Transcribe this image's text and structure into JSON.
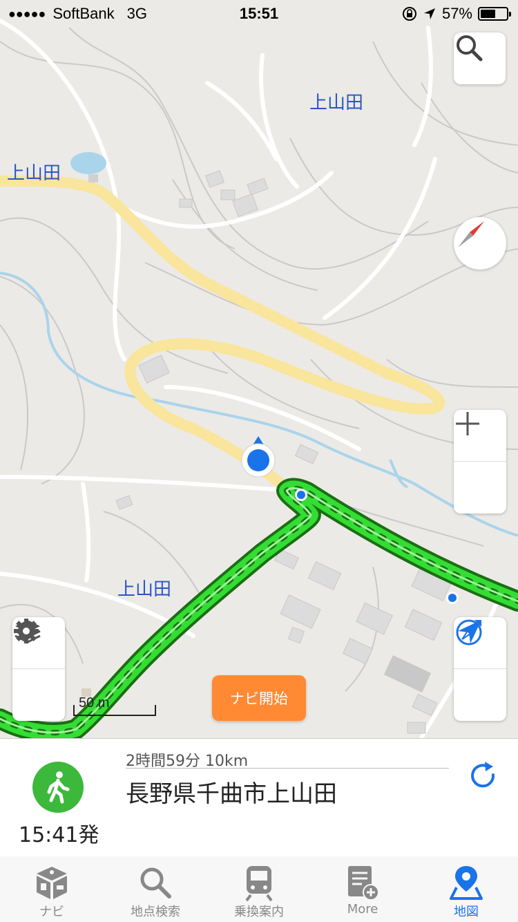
{
  "status_bar": {
    "signal": "●●●●●",
    "carrier": "SoftBank",
    "network": "3G",
    "time": "15:51",
    "battery": "57%",
    "battery_level": 0.57
  },
  "map": {
    "labels": [
      "上山田",
      "上山田",
      "上山田"
    ],
    "scale": "50 m",
    "navi_start": "ナビ開始",
    "route_color": "#33cc33",
    "road_color": "#f9e59b",
    "river_color": "#a9d4ec"
  },
  "route_info": {
    "duration_distance": "2時間59分 10km",
    "destination": "長野県千曲市上山田",
    "departure": "15:41発"
  },
  "tabs": [
    {
      "label": "ナビ",
      "icon": "navi-cube-icon"
    },
    {
      "label": "地点検索",
      "icon": "search-icon"
    },
    {
      "label": "乗換案内",
      "icon": "train-icon"
    },
    {
      "label": "More",
      "icon": "more-doc-icon"
    },
    {
      "label": "地図",
      "icon": "map-pin-icon",
      "active": true
    }
  ]
}
